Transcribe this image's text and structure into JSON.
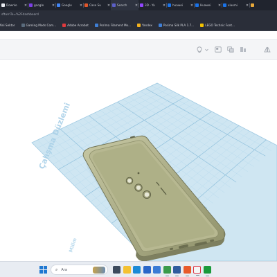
{
  "browser": {
    "tabs": [
      {
        "label": "Downlo",
        "favicon_color": "#e8eaf0"
      },
      {
        "label": "google",
        "favicon_color": "#7b3fe4"
      },
      {
        "label": "Google",
        "favicon_color": "#4285f4"
      },
      {
        "label": "Case Su",
        "favicon_color": "#e2572b"
      },
      {
        "label": "Search",
        "favicon_color": "#5b5fc7"
      },
      {
        "label": "3D - Ya",
        "favicon_color": "#9146ff"
      },
      {
        "label": "huawei",
        "favicon_color": "#1a73e8"
      },
      {
        "label": "Huawei",
        "favicon_color": "#1a73e8"
      },
      {
        "label": "xiaomi",
        "favicon_color": "#1a73e8"
      },
      {
        "label": "",
        "favicon_color": "#e8a83a"
      }
    ],
    "url": "sfturnTo=%2Fdashboard",
    "bookmarks": [
      {
        "label": "Mini Sektor",
        "icon_color": "#3d8bfd"
      },
      {
        "label": "Gaming Mods Com...",
        "icon_color": "#5a6b7c"
      },
      {
        "label": "Adobe Acrobat",
        "icon_color": "#e03a3e"
      },
      {
        "label": "Porima Filament Mo...",
        "icon_color": "#3f7fd6"
      },
      {
        "label": "Yandex",
        "icon_color": "#f3b21e"
      },
      {
        "label": "Porima Silk PLA 1.7...",
        "icon_color": "#3f7fd6"
      },
      {
        "label": "LEGO Technic Font...",
        "icon_color": "#f2c200"
      }
    ]
  },
  "tinkercad": {
    "toolbar_icons": [
      "lightbulb-icon",
      "chevron-down-icon",
      "note-icon",
      "group-icon",
      "align-icon",
      "mirror-icon"
    ],
    "workplane_label": "Çalışma Düzlemi",
    "units_label": "Milim",
    "workplane_color": "#cfe6f2",
    "grid_color": "#9ec9e2",
    "model_color": "#b2b38a"
  },
  "taskbar": {
    "search_placeholder": "Ara",
    "apps": [
      {
        "icon": "task-view-icon",
        "color": "#3c4a5c"
      },
      {
        "icon": "file-explorer-icon",
        "color": "#f4c132"
      },
      {
        "icon": "edge-icon",
        "color": "#1b8ad7"
      },
      {
        "icon": "mail-icon",
        "color": "#2b67c8"
      },
      {
        "icon": "store-icon",
        "color": "#3a7bd5"
      },
      {
        "icon": "chrome-icon",
        "color": "#3b9b4a"
      },
      {
        "icon": "terminal-icon",
        "color": "#2f5c9e"
      },
      {
        "icon": "app-icon",
        "color": "#e85a2b"
      },
      {
        "icon": "yandex-browser-icon",
        "color": "#f5f5f5"
      },
      {
        "icon": "game-icon",
        "color": "#1a9a3a"
      }
    ]
  }
}
